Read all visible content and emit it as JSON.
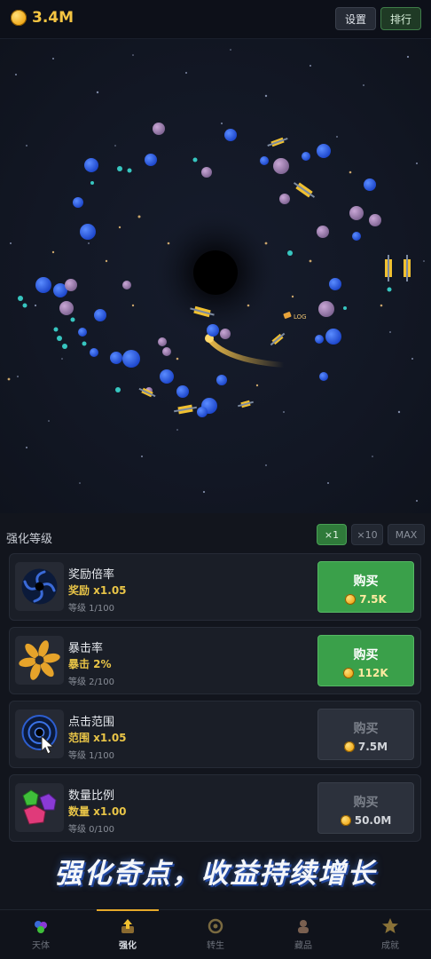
{
  "header": {
    "coins": "3.4M",
    "settings_label": "设置",
    "rank_label": "排行"
  },
  "space": {
    "floating_label": "LOG",
    "icons": [
      "black-hole-icon",
      "asteroid-icon",
      "satellite-icon",
      "crystal-icon",
      "comet-icon"
    ]
  },
  "panel": {
    "title": "强化等级",
    "multipliers": [
      "×1",
      "×10",
      "MAX"
    ],
    "selected_multiplier": "×1",
    "upgrades": [
      {
        "name": "奖励倍率",
        "effect": "奖励 x1.05",
        "level": "等级 1/100",
        "buy_label": "购买",
        "price": "7.5K",
        "enabled": true,
        "icon": "vortex-icon"
      },
      {
        "name": "暴击率",
        "effect": "暴击 2%",
        "level": "等级 2/100",
        "buy_label": "购买",
        "price": "112K",
        "enabled": true,
        "icon": "golden-spiral-icon"
      },
      {
        "name": "点击范围",
        "effect": "范围 x1.05",
        "level": "等级 1/100",
        "buy_label": "购买",
        "price": "7.5M",
        "enabled": false,
        "icon": "click-range-icon"
      },
      {
        "name": "数量比例",
        "effect": "数量 x1.00",
        "level": "等级 0/100",
        "buy_label": "购买",
        "price": "50.0M",
        "enabled": false,
        "icon": "gem-cluster-icon"
      }
    ]
  },
  "slogan": "强化奇点，收益持续增长",
  "nav": {
    "items": [
      {
        "label": "天体",
        "icon": "celestial-icon"
      },
      {
        "label": "强化",
        "icon": "upgrade-icon"
      },
      {
        "label": "转生",
        "icon": "rebirth-icon"
      },
      {
        "label": "藏品",
        "icon": "collection-icon"
      },
      {
        "label": "成就",
        "icon": "star-icon"
      }
    ],
    "active": "强化"
  },
  "colors": {
    "accent_green": "#3aa04a",
    "coin_gold": "#f5c542",
    "space_bg": "#121724",
    "nav_active": "#e6a92a"
  }
}
